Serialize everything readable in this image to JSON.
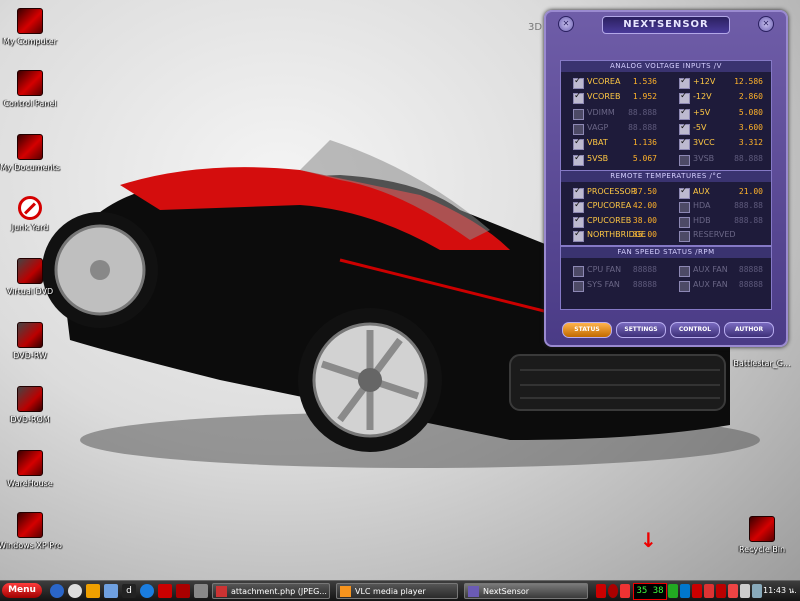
{
  "desktop": {
    "icons": [
      {
        "label": "My Computer"
      },
      {
        "label": "Control Panel"
      },
      {
        "label": "My Documents"
      },
      {
        "label": "Junk Yard"
      },
      {
        "label": "Virtual DVD"
      },
      {
        "label": "DVD-RW"
      },
      {
        "label": "DVD-ROM"
      },
      {
        "label": "WareHouse"
      },
      {
        "label": "Windows XP Pro"
      }
    ],
    "right_icons": [
      {
        "label": "Battlestar_G..."
      },
      {
        "label": "Recycle Bin"
      }
    ]
  },
  "nextsensor": {
    "title": "NEXTSENSOR",
    "tag": "3D",
    "voltage": {
      "header": "ANALOG VOLTAGE INPUTS /V",
      "left": [
        {
          "name": "VCOREA",
          "value": "1.536",
          "checked": true
        },
        {
          "name": "VCOREB",
          "value": "1.952",
          "checked": true
        },
        {
          "name": "VDIMM",
          "value": "88.888",
          "checked": false
        },
        {
          "name": "VAGP",
          "value": "88.888",
          "checked": false
        },
        {
          "name": "VBAT",
          "value": "1.136",
          "checked": true
        },
        {
          "name": "5VSB",
          "value": "5.067",
          "checked": true
        }
      ],
      "right": [
        {
          "name": "+12V",
          "value": "12.586",
          "checked": true
        },
        {
          "name": "-12V",
          "value": "2.860",
          "checked": true
        },
        {
          "name": "+5V",
          "value": "5.080",
          "checked": true
        },
        {
          "name": "-5V",
          "value": "3.600",
          "checked": true
        },
        {
          "name": "3VCC",
          "value": "3.312",
          "checked": true
        },
        {
          "name": "3VSB",
          "value": "88.888",
          "checked": false
        }
      ]
    },
    "temps": {
      "header": "REMOTE TEMPERATURES /°C",
      "left": [
        {
          "name": "PROCESSOR",
          "value": "37.50",
          "checked": true
        },
        {
          "name": "CPUCOREA",
          "value": "42.00",
          "checked": true
        },
        {
          "name": "CPUCOREB",
          "value": "38.00",
          "checked": true
        },
        {
          "name": "NORTHBRIDGE",
          "value": "35.00",
          "checked": true
        }
      ],
      "right": [
        {
          "name": "AUX",
          "value": "21.00",
          "checked": true
        },
        {
          "name": "HDA",
          "value": "888.88",
          "checked": false
        },
        {
          "name": "HDB",
          "value": "888.88",
          "checked": false
        },
        {
          "name": "RESERVED",
          "value": "",
          "checked": false
        }
      ]
    },
    "fans": {
      "header": "FAN SPEED STATUS /RPM",
      "left": [
        {
          "name": "CPU FAN",
          "value": "88888",
          "checked": false
        },
        {
          "name": "SYS FAN",
          "value": "88888",
          "checked": false
        }
      ],
      "right": [
        {
          "name": "AUX FAN",
          "value": "88888",
          "checked": false
        },
        {
          "name": "AUX FAN",
          "value": "88888",
          "checked": false
        }
      ]
    },
    "tabs": [
      "STATUS",
      "SETTINGS",
      "CONTROL",
      "AUTHOR"
    ],
    "active_tab": "STATUS"
  },
  "taskbar": {
    "start_label": "Menu",
    "tasks": [
      {
        "label": "attachment.php (JPEG..."
      },
      {
        "label": "VLC media player"
      },
      {
        "label": "NextSensor"
      }
    ],
    "tray_readout": "35 38",
    "clock": "11:43 น."
  },
  "annotation": {
    "arrow": "↓"
  }
}
